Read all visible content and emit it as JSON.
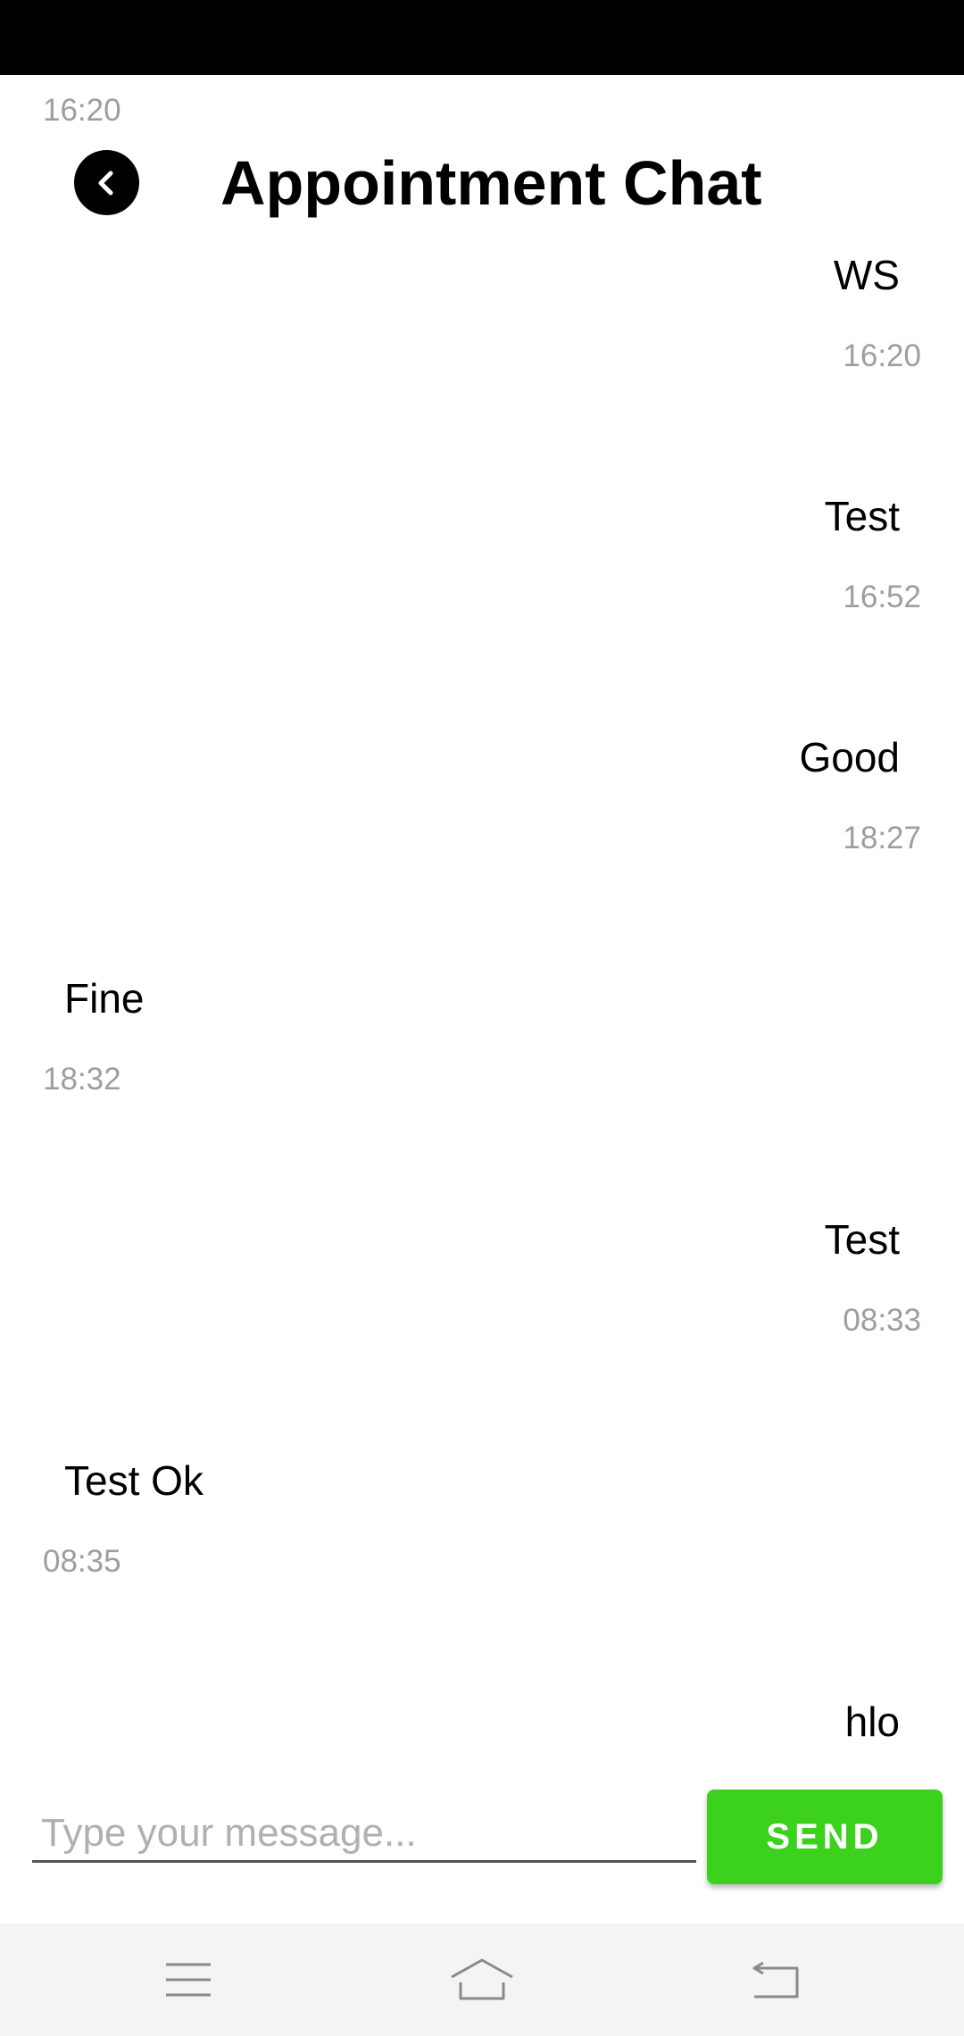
{
  "app": {
    "title": "Appointment Chat",
    "top_time": "16:20",
    "accent_color": "#3bd11c"
  },
  "messages": [
    {
      "side": "right",
      "text": "WS",
      "time": "16:20"
    },
    {
      "side": "right",
      "text": "Test",
      "time": "16:52"
    },
    {
      "side": "right",
      "text": "Good",
      "time": "18:27"
    },
    {
      "side": "left",
      "text": "Fine",
      "time": "18:32"
    },
    {
      "side": "right",
      "text": "Test",
      "time": "08:33"
    },
    {
      "side": "left",
      "text": "Test Ok",
      "time": "08:35"
    },
    {
      "side": "right",
      "text": "hlo",
      "time": ""
    }
  ],
  "composer": {
    "placeholder": "Type your message...",
    "value": "",
    "send_label": "SEND"
  },
  "nav": {
    "icons": [
      "menu-icon",
      "home-icon",
      "back-icon"
    ]
  }
}
